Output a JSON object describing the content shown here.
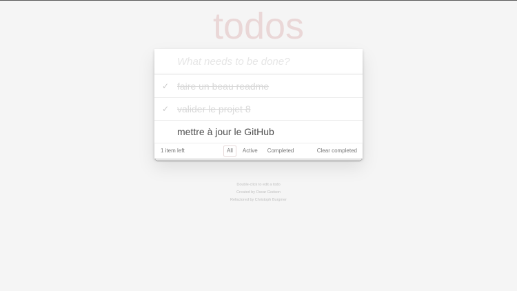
{
  "header": {
    "title": "todos"
  },
  "new_todo": {
    "placeholder": "What needs to be done?",
    "value": ""
  },
  "todos": [
    {
      "label": "faire un beau readme",
      "completed": true,
      "toggle_icon": "check-icon"
    },
    {
      "label": "valider le projet 8",
      "completed": true,
      "toggle_icon": "check-icon"
    },
    {
      "label": "mettre à jour le GitHub",
      "completed": false,
      "toggle_icon": ""
    }
  ],
  "toggle_glyph": "✓",
  "footer": {
    "count_text": "1 item left",
    "filters": [
      {
        "label": "All",
        "selected": true
      },
      {
        "label": "Active",
        "selected": false
      },
      {
        "label": "Completed",
        "selected": false
      }
    ],
    "clear_label": "Clear completed"
  },
  "info": {
    "line1": "Double-click to edit a todo",
    "line2": "Created by Oscar Godson",
    "line3": "Refactored by Christoph Burgmer"
  },
  "colors": {
    "background": "#f5f5f5",
    "title": "#ead7d7",
    "completed_text": "#d9d9d9"
  }
}
